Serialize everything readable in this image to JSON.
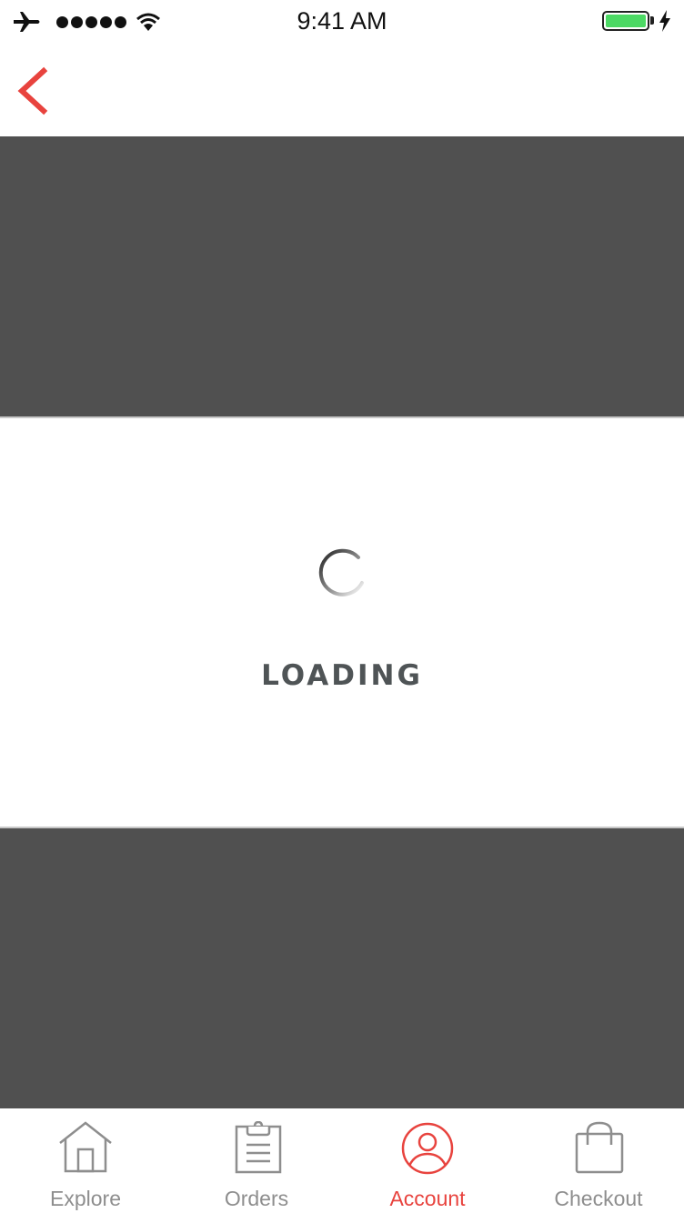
{
  "status_bar": {
    "time": "9:41 AM",
    "airplane_icon": "airplane-icon",
    "signal_dots": 5,
    "wifi_icon": "wifi-icon",
    "battery_level": 1.0,
    "battery_color": "#4cd964",
    "charging_icon": "bolt-icon"
  },
  "nav": {
    "back_icon": "chevron-left-icon",
    "accent_color": "#e8433e"
  },
  "loading": {
    "label": "LOADING",
    "spinner_icon": "spinner-icon"
  },
  "tab_bar": {
    "active_index": 2,
    "active_color": "#e8433e",
    "inactive_color": "#8e8e8e",
    "tabs": [
      {
        "label": "Explore",
        "icon": "home-icon"
      },
      {
        "label": "Orders",
        "icon": "clipboard-icon"
      },
      {
        "label": "Account",
        "icon": "user-circle-icon"
      },
      {
        "label": "Checkout",
        "icon": "shopping-bag-icon"
      }
    ]
  }
}
